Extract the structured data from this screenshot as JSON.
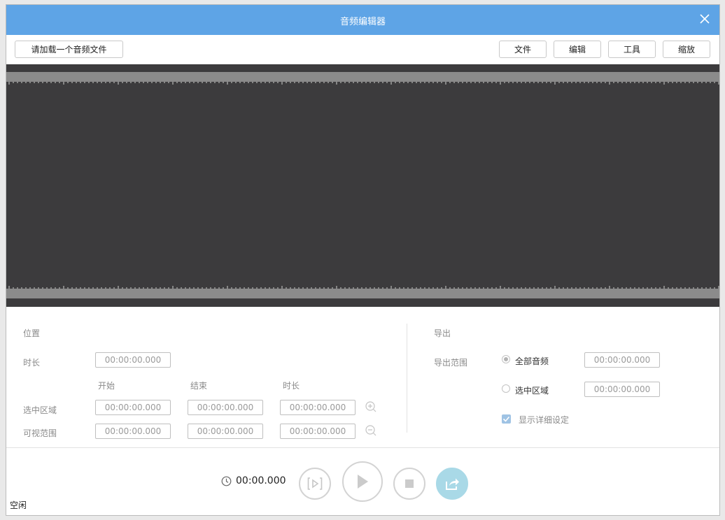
{
  "window": {
    "title": "音频编辑器"
  },
  "toolbar": {
    "load_label": "请加载一个音频文件",
    "file_label": "文件",
    "edit_label": "编辑",
    "tools_label": "工具",
    "zoom_label": "缩放"
  },
  "position": {
    "section_title": "位置",
    "duration_label": "时长",
    "duration_value": "00:00:00.000",
    "col_start": "开始",
    "col_end": "结束",
    "col_duration": "时长",
    "selection_label": "选中区域",
    "selection_start": "00:00:00.000",
    "selection_end": "00:00:00.000",
    "selection_duration": "00:00:00.000",
    "visible_label": "可视范围",
    "visible_start": "00:00:00.000",
    "visible_end": "00:00:00.000",
    "visible_duration": "00:00:00.000"
  },
  "export": {
    "section_title": "导出",
    "range_label": "导出范围",
    "all_audio_label": "全部音频",
    "all_audio_value": "00:00:00.000",
    "selection_label": "选中区域",
    "selection_value": "00:00:00.000",
    "detail_label": "显示详细设定",
    "selected_range": "全部音频",
    "detail_checked": true
  },
  "transport": {
    "time": "00:00.000"
  },
  "status": {
    "text": "空闲"
  },
  "colors": {
    "titlebar": "#5ea4e6",
    "waveform_bg": "#3c3b3d",
    "waveform_band": "#8b8b8b",
    "export_button": "#a9d9e7"
  },
  "icons": [
    "close-icon",
    "zoom-in-icon",
    "zoom-out-icon",
    "clock-icon",
    "play-selection-icon",
    "play-icon",
    "stop-icon",
    "export-icon",
    "check-icon"
  ]
}
